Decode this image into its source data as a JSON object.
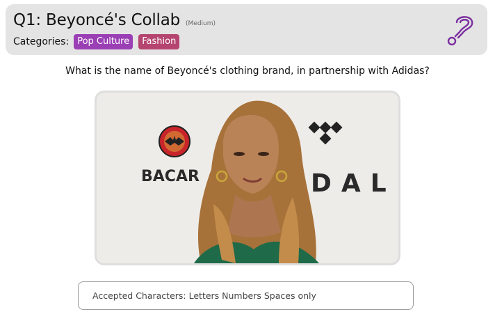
{
  "header": {
    "title": "Q1: Beyoncé's Collab",
    "difficulty": "(Medium)",
    "categories_label": "Categories:",
    "categories": [
      {
        "label": "Pop Culture",
        "color": "#9b3fb5"
      },
      {
        "label": "Fashion",
        "color": "#b54570"
      }
    ],
    "help_icon": "question-mark-icon"
  },
  "question": {
    "text": "What is the name of Beyoncé's clothing brand, in partnership with Adidas?"
  },
  "image": {
    "backdrop_text_left": "BACAR",
    "backdrop_text_right": "DAL"
  },
  "answer": {
    "placeholder": "Accepted Characters: Letters Numbers Spaces only",
    "value": ""
  },
  "colors": {
    "header_bg": "#e4e4e4",
    "accent_purple": "#9b3fb5",
    "accent_magenta": "#b54570",
    "help_icon": "#7b2fa0"
  }
}
